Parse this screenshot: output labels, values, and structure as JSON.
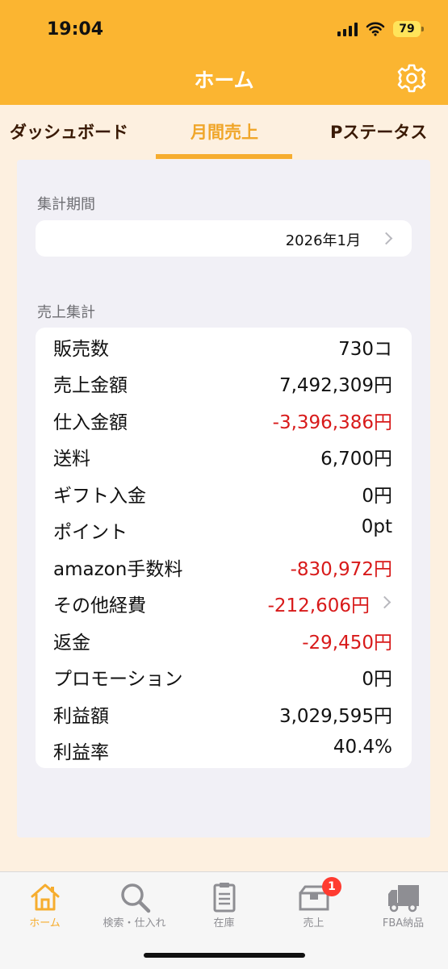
{
  "status_bar": {
    "time": "19:04",
    "battery": "79"
  },
  "nav": {
    "title": "ホーム"
  },
  "tabs": [
    {
      "label": "ダッシュボード"
    },
    {
      "label": "月間売上"
    },
    {
      "label": "Pステータス"
    }
  ],
  "period": {
    "section_label": "集計期間",
    "value": "2026年1月"
  },
  "summary": {
    "section_label": "売上集計",
    "rows": [
      {
        "label": "販売数",
        "value": "730コ"
      },
      {
        "label": "売上金額",
        "value": "7,492,309円"
      },
      {
        "label": "仕入金額",
        "value": "-3,396,386円"
      },
      {
        "label": "送料",
        "value": "6,700円"
      },
      {
        "label": "ギフト入金",
        "value": "0円"
      },
      {
        "label": "ポイント",
        "value": "0pt"
      },
      {
        "label": "amazon手数料",
        "value": "-830,972円"
      },
      {
        "label": "その他経費",
        "value": "-212,606円"
      },
      {
        "label": "返金",
        "value": "-29,450円"
      },
      {
        "label": "プロモーション",
        "value": "0円"
      },
      {
        "label": "利益額",
        "value": "3,029,595円"
      },
      {
        "label": "利益率",
        "value": "40.4%"
      }
    ]
  },
  "tabbar": {
    "items": [
      {
        "label": "ホーム",
        "icon": "home-icon"
      },
      {
        "label": "検索・仕入れ",
        "icon": "search-icon"
      },
      {
        "label": "在庫",
        "icon": "clipboard-icon"
      },
      {
        "label": "売上",
        "icon": "box-icon",
        "badge": "1"
      },
      {
        "label": "FBA納品",
        "icon": "truck-icon"
      }
    ]
  },
  "colors": {
    "accent": "#fbb531",
    "negative": "#d81a1a",
    "active_tab": "#f6ad2f"
  }
}
